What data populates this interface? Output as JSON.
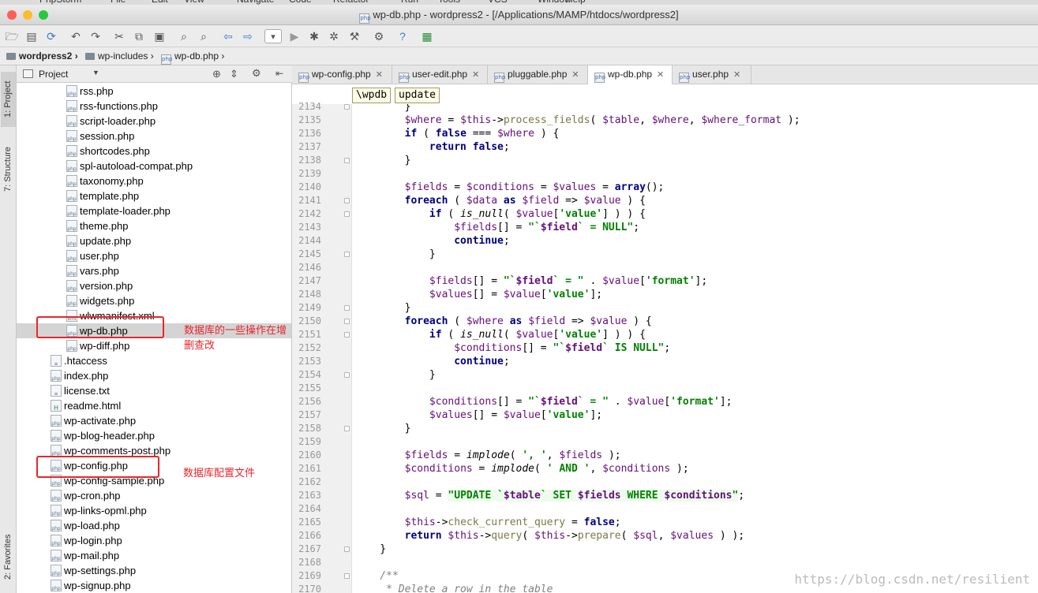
{
  "menubar": {
    "items": [
      "PhpStorm",
      "File",
      "Edit",
      "View",
      "Navigate",
      "Code",
      "Refactor",
      "Run",
      "Tools",
      "VCS",
      "Window",
      "Help"
    ]
  },
  "window": {
    "title": "wp-db.php - wordpress2 - [/Applications/MAMP/htdocs/wordpress2]"
  },
  "toolbar": {
    "icons": [
      "folder-open-icon",
      "save-icon",
      "sync-icon",
      "undo-icon",
      "redo-icon",
      "cut-icon",
      "copy-icon",
      "paste-icon",
      "find-icon",
      "replace-icon",
      "back-icon",
      "forward-icon",
      "run-config-dropdown",
      "run-icon",
      "debug-icon",
      "coverage-icon",
      "build-icon",
      "settings-icon",
      "help-icon",
      "plugin-icon"
    ]
  },
  "nav": {
    "crumbs": [
      "wordpress2",
      "wp-includes",
      "wp-db.php"
    ]
  },
  "left_strip": {
    "tab_project": "1: Project",
    "tab_structure": "7: Structure",
    "tab_favorites": "2: Favorites"
  },
  "project_panel": {
    "title": "Project"
  },
  "tree": [
    {
      "name": "rss.php",
      "icon": "php-file",
      "indent": 2
    },
    {
      "name": "rss-functions.php",
      "icon": "php-file",
      "indent": 2
    },
    {
      "name": "script-loader.php",
      "icon": "php-file",
      "indent": 2
    },
    {
      "name": "session.php",
      "icon": "php-file",
      "indent": 2
    },
    {
      "name": "shortcodes.php",
      "icon": "php-file",
      "indent": 2
    },
    {
      "name": "spl-autoload-compat.php",
      "icon": "php-file",
      "indent": 2
    },
    {
      "name": "taxonomy.php",
      "icon": "php-file",
      "indent": 2
    },
    {
      "name": "template.php",
      "icon": "php-file",
      "indent": 2
    },
    {
      "name": "template-loader.php",
      "icon": "php-file",
      "indent": 2
    },
    {
      "name": "theme.php",
      "icon": "php-file",
      "indent": 2
    },
    {
      "name": "update.php",
      "icon": "php-file",
      "indent": 2
    },
    {
      "name": "user.php",
      "icon": "php-file",
      "indent": 2
    },
    {
      "name": "vars.php",
      "icon": "php-file",
      "indent": 2
    },
    {
      "name": "version.php",
      "icon": "php-file",
      "indent": 2
    },
    {
      "name": "widgets.php",
      "icon": "php-file",
      "indent": 2
    },
    {
      "name": "wlwmanifest.xml",
      "icon": "xml-file",
      "indent": 2
    },
    {
      "name": "wp-db.php",
      "icon": "php-file",
      "indent": 2,
      "selected": true
    },
    {
      "name": "wp-diff.php",
      "icon": "php-file",
      "indent": 2
    },
    {
      "name": ".htaccess",
      "icon": "text-file",
      "indent": 1
    },
    {
      "name": "index.php",
      "icon": "php-file",
      "indent": 1
    },
    {
      "name": "license.txt",
      "icon": "text-file",
      "indent": 1
    },
    {
      "name": "readme.html",
      "icon": "html-file",
      "indent": 1
    },
    {
      "name": "wp-activate.php",
      "icon": "php-file",
      "indent": 1
    },
    {
      "name": "wp-blog-header.php",
      "icon": "php-file",
      "indent": 1
    },
    {
      "name": "wp-comments-post.php",
      "icon": "php-file",
      "indent": 1
    },
    {
      "name": "wp-config.php",
      "icon": "php-file",
      "indent": 1
    },
    {
      "name": "wp-config-sample.php",
      "icon": "php-file",
      "indent": 1
    },
    {
      "name": "wp-cron.php",
      "icon": "php-file",
      "indent": 1
    },
    {
      "name": "wp-links-opml.php",
      "icon": "php-file",
      "indent": 1
    },
    {
      "name": "wp-load.php",
      "icon": "php-file",
      "indent": 1
    },
    {
      "name": "wp-login.php",
      "icon": "php-file",
      "indent": 1
    },
    {
      "name": "wp-mail.php",
      "icon": "php-file",
      "indent": 1
    },
    {
      "name": "wp-settings.php",
      "icon": "php-file",
      "indent": 1
    },
    {
      "name": "wp-signup.php",
      "icon": "php-file",
      "indent": 1
    }
  ],
  "annotations": {
    "db_ops": "数据库的一些操作在增删查改",
    "db_config": "数据库配置文件"
  },
  "tabs": [
    {
      "label": "wp-config.php",
      "active": false
    },
    {
      "label": "user-edit.php",
      "active": false
    },
    {
      "label": "pluggable.php",
      "active": false
    },
    {
      "label": "wp-db.php",
      "active": true
    },
    {
      "label": "user.php",
      "active": false
    }
  ],
  "editor_breadcrumb": [
    "\\wpdb",
    "update"
  ],
  "code": [
    {
      "n": "2134",
      "t": "        }"
    },
    {
      "n": "2135",
      "t": "        $where = $this->process_fields( $table, $where, $where_format );"
    },
    {
      "n": "2136",
      "t": "        if ( false === $where ) {"
    },
    {
      "n": "2137",
      "t": "            return false;"
    },
    {
      "n": "2138",
      "t": "        }"
    },
    {
      "n": "2139",
      "t": ""
    },
    {
      "n": "2140",
      "t": "        $fields = $conditions = $values = array();"
    },
    {
      "n": "2141",
      "t": "        foreach ( $data as $field => $value ) {"
    },
    {
      "n": "2142",
      "t": "            if ( is_null( $value['value'] ) ) {"
    },
    {
      "n": "2143",
      "t": "                $fields[] = \"`$field` = NULL\";"
    },
    {
      "n": "2144",
      "t": "                continue;"
    },
    {
      "n": "2145",
      "t": "            }"
    },
    {
      "n": "2146",
      "t": ""
    },
    {
      "n": "2147",
      "t": "            $fields[] = \"`$field` = \" . $value['format'];"
    },
    {
      "n": "2148",
      "t": "            $values[] = $value['value'];"
    },
    {
      "n": "2149",
      "t": "        }"
    },
    {
      "n": "2150",
      "t": "        foreach ( $where as $field => $value ) {"
    },
    {
      "n": "2151",
      "t": "            if ( is_null( $value['value'] ) ) {"
    },
    {
      "n": "2152",
      "t": "                $conditions[] = \"`$field` IS NULL\";"
    },
    {
      "n": "2153",
      "t": "                continue;"
    },
    {
      "n": "2154",
      "t": "            }"
    },
    {
      "n": "2155",
      "t": ""
    },
    {
      "n": "2156",
      "t": "            $conditions[] = \"`$field` = \" . $value['format'];"
    },
    {
      "n": "2157",
      "t": "            $values[] = $value['value'];"
    },
    {
      "n": "2158",
      "t": "        }"
    },
    {
      "n": "2159",
      "t": ""
    },
    {
      "n": "2160",
      "t": "        $fields = implode( ', ', $fields );"
    },
    {
      "n": "2161",
      "t": "        $conditions = implode( ' AND ', $conditions );"
    },
    {
      "n": "2162",
      "t": ""
    },
    {
      "n": "2163",
      "t": "        $sql = \"UPDATE `$table` SET $fields WHERE $conditions\";"
    },
    {
      "n": "2164",
      "t": ""
    },
    {
      "n": "2165",
      "t": "        $this->check_current_query = false;"
    },
    {
      "n": "2166",
      "t": "        return $this->query( $this->prepare( $sql, $values ) );"
    },
    {
      "n": "2167",
      "t": "    }"
    },
    {
      "n": "2168",
      "t": ""
    },
    {
      "n": "2169",
      "t": "    /**"
    },
    {
      "n": "2170",
      "t": "     * Delete a row in the table"
    }
  ],
  "watermark": "https://blog.csdn.net/resilient",
  "colors": {
    "annotation_red": "#e8262b",
    "keyword": "#000080",
    "string": "#008000",
    "variable": "#660e7a"
  }
}
